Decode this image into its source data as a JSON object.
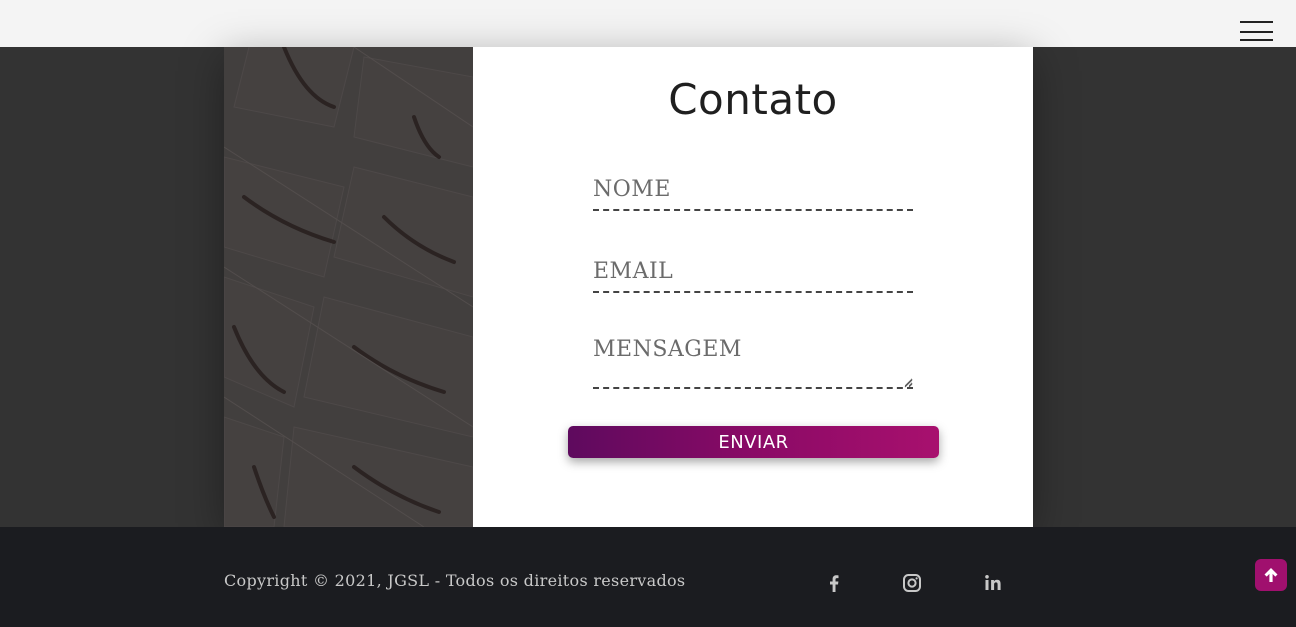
{
  "header": {
    "menu_icon": "hamburger-menu-icon"
  },
  "contact": {
    "title": "Contato",
    "name_placeholder": "NOME",
    "email_placeholder": "EMAIL",
    "message_placeholder": "MENSAGEM",
    "submit_label": "ENVIAR"
  },
  "footer": {
    "copyright": "Copyright © 2021, JGSL - Todos os direitos reservados",
    "social_icons": [
      "facebook-icon",
      "instagram-icon",
      "linkedin-icon"
    ]
  },
  "scroll_top": {
    "icon": "arrow-up-icon"
  },
  "colors": {
    "accent_start": "#5e0a5e",
    "accent_end": "#a8106e",
    "header_bg": "#f4f4f4",
    "page_bg": "#333333",
    "footer_bg": "#1b1c20"
  }
}
